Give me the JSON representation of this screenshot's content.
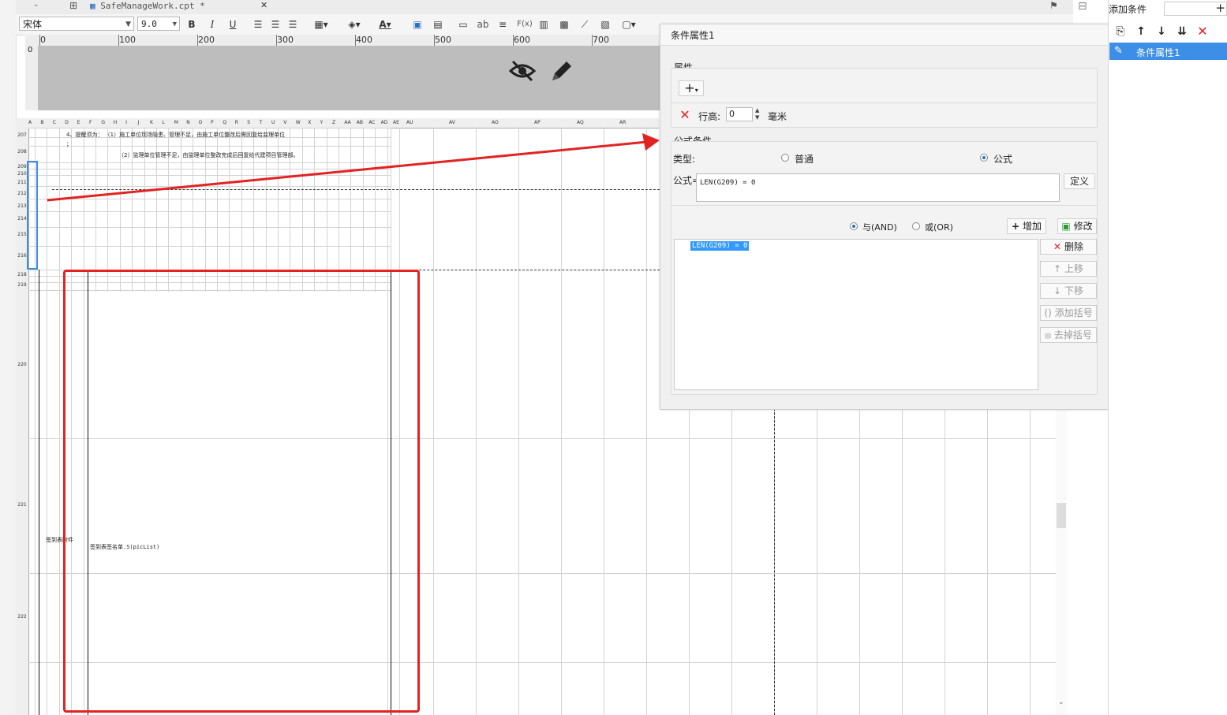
{
  "file_tab": {
    "title": "SafeManageWork.cpt *",
    "close": "✕"
  },
  "toolbar": {
    "font_name": "宋体",
    "font_size": "9.0",
    "bold": "B",
    "italic": "I",
    "underline": "U",
    "font_color": "A",
    "text_tool": "ab",
    "formula_tool": "F(x)"
  },
  "ruler": {
    "marks": [
      "0",
      "100",
      "200",
      "300",
      "400",
      "500",
      "600",
      "700"
    ],
    "vmark": "0"
  },
  "overlay": {
    "hide_icon": "eye-off-icon",
    "edit_icon": "pencil-icon"
  },
  "grid": {
    "column_headers": [
      "A",
      "B",
      "C",
      "D",
      "E",
      "F",
      "G",
      "H",
      "I",
      "J",
      "K",
      "L",
      "M",
      "N",
      "O",
      "P",
      "Q",
      "R",
      "S",
      "T",
      "U",
      "V",
      "W",
      "X",
      "Y",
      "Z",
      "AA",
      "AB",
      "AC",
      "AD",
      "AE",
      "AU",
      "AV",
      "AO",
      "AP",
      "AQ",
      "AR"
    ],
    "row_labels": [
      "207",
      "208",
      "209",
      "210",
      "211",
      "212",
      "213",
      "214",
      "215",
      "216",
      "218",
      "219",
      "220",
      "221",
      "222"
    ],
    "cell_207": "4、提醒须为：  （1）施工单位现场隐患、管理不足，由施工单位整改后需回复给监理单位",
    "cell_207b": "；",
    "cell_208": "（2）监理单位管理不足，由监理单位整改完成后回复给代建项目管理部。",
    "cell_sign_label": "签到表附件",
    "cell_sign_value": "签到表签名单.S(picList)"
  },
  "dialog": {
    "title": "条件属性1",
    "attr_section": "属性",
    "add_attr": "+",
    "row_height_label": "行高:",
    "row_height_value": "0",
    "row_height_unit": "毫米",
    "formula_section": "公式条件",
    "type_label": "类型:",
    "type_normal": "普通",
    "type_formula": "公式",
    "formula_label": "公式=",
    "formula_value": "LEN(G209) = 0",
    "define_button": "定义",
    "and_label": "与(AND)",
    "or_label": "或(OR)",
    "add_button": "增加",
    "modify_button": "修改",
    "condition_items": [
      "LEN(G209) = 0"
    ],
    "delete_button": "删除",
    "up_button": "上移",
    "down_button": "下移",
    "add_bracket_button": "添加括号",
    "remove_bracket_button": "去掉括号"
  },
  "right_panel": {
    "title": "添加条件",
    "add": "+",
    "items": [
      "条件属性1"
    ]
  },
  "colors": {
    "accent": "#3d8ee6",
    "annotation": "#e32222",
    "selection": "#3399ff"
  }
}
